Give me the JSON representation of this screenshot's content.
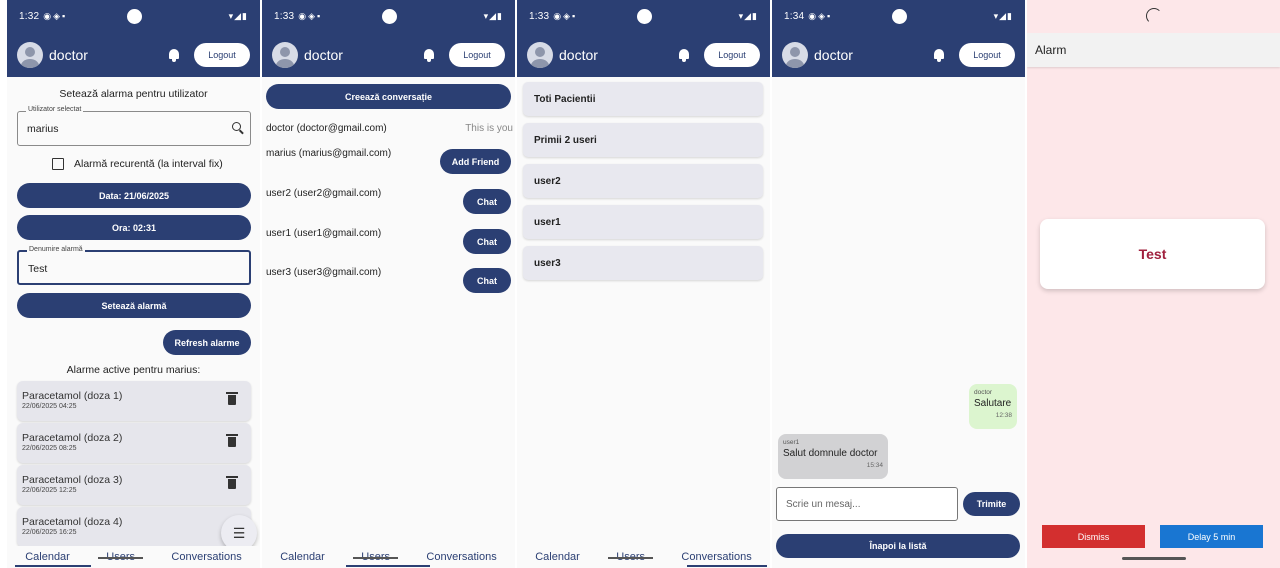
{
  "colors": {
    "primary": "#2b3f73",
    "alarm_bg": "#fde7e9",
    "dismiss": "#d32f2f",
    "delay": "#1976d2"
  },
  "header": {
    "username": "doctor",
    "logout_label": "Logout"
  },
  "nav": [
    "Calendar",
    "Users",
    "Conversations"
  ],
  "phone1": {
    "time": "1:32",
    "title": "Setează alarma pentru utilizator",
    "user_field": {
      "label": "Utilizator selectat",
      "value": "marius"
    },
    "recurring_label": "Alarmă recurentă (la interval fix)",
    "date_button": "Data: 21/06/2025",
    "time_button": "Ora: 02:31",
    "name_field": {
      "label": "Denumire alarmă",
      "value": "Test"
    },
    "set_button": "Setează alarmă",
    "refresh_button": "Refresh alarme",
    "list_title": "Alarme active pentru marius:",
    "alarms": [
      {
        "name": "Paracetamol (doza 1)",
        "date": "22/06/2025 04:25"
      },
      {
        "name": "Paracetamol (doza 2)",
        "date": "22/06/2025 08:25"
      },
      {
        "name": "Paracetamol (doza 3)",
        "date": "22/06/2025 12:25"
      },
      {
        "name": "Paracetamol (doza 4)",
        "date": "22/06/2025 16:25"
      }
    ]
  },
  "phone2": {
    "time": "1:33",
    "create_button": "Creează conversație",
    "self_user": "doctor (doctor@gmail.com)",
    "self_note": "This is you",
    "users": [
      {
        "label": "marius (marius@gmail.com)",
        "action": "Add Friend"
      },
      {
        "label": "user2 (user2@gmail.com)",
        "action": "Chat"
      },
      {
        "label": "user1 (user1@gmail.com)",
        "action": "Chat"
      },
      {
        "label": "user3 (user3@gmail.com)",
        "action": "Chat"
      }
    ]
  },
  "phone3": {
    "time": "1:33",
    "conversations": [
      "Toti Pacientii",
      "Primii 2 useri",
      "user2",
      "user1",
      "user3"
    ]
  },
  "phone4": {
    "time": "1:34",
    "messages": [
      {
        "sender": "doctor",
        "text": "Salutare",
        "time": "12:38"
      },
      {
        "sender": "user1",
        "text": "Salut domnule doctor",
        "time": "15:34"
      }
    ],
    "input_placeholder": "Scrie un mesaj...",
    "send_button": "Trimite",
    "back_button": "Înapoi la listă"
  },
  "phone5": {
    "title": "Alarm",
    "alarm_name": "Test",
    "dismiss_button": "Dismiss",
    "delay_button": "Delay 5 min"
  }
}
